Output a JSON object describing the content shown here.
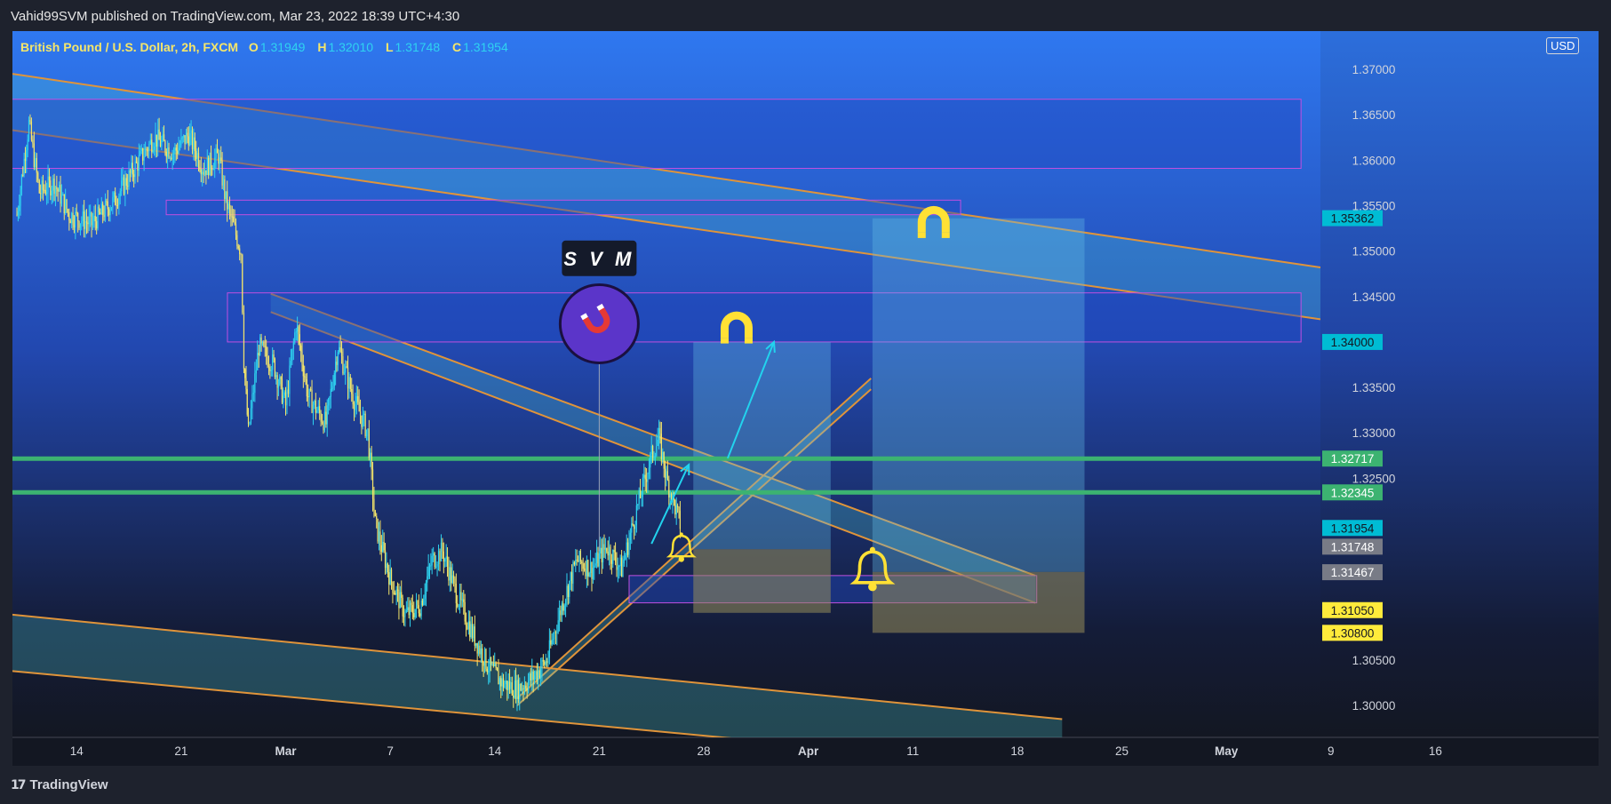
{
  "header": {
    "publisher": "Vahid99SVM published on TradingView.com, Mar 23, 2022 18:39 UTC+4:30"
  },
  "legend": {
    "symbol": "British Pound / U.S. Dollar, 2h, FXCM",
    "o_label": "O",
    "open": "1.31949",
    "h_label": "H",
    "high": "1.32010",
    "l_label": "L",
    "low": "1.31748",
    "c_label": "C",
    "close": "1.31954"
  },
  "currency_button": "USD",
  "watermark": {
    "text": "S V M",
    "icon": "magnet-icon"
  },
  "footer": {
    "brand": "TradingView",
    "icon": "tradingview-logo-icon"
  },
  "colors": {
    "bull": "#2ed3f0",
    "bear": "#f5e66a",
    "support": "#3cb371",
    "channel": "#e0943a",
    "zone_border": "#c14fe0"
  },
  "chart_data": {
    "type": "candlestick",
    "symbol": "GBPUSD",
    "interval": "2h",
    "ylim": [
      1.2965,
      1.3742
    ],
    "x_range_days": [
      -22.3,
      65.3
    ],
    "x_ticks": [
      {
        "day": -18,
        "label": "14"
      },
      {
        "day": -11,
        "label": "21"
      },
      {
        "day": -4,
        "label": "Mar"
      },
      {
        "day": 3,
        "label": "7"
      },
      {
        "day": 10,
        "label": "14"
      },
      {
        "day": 17,
        "label": "21"
      },
      {
        "day": 24,
        "label": "28"
      },
      {
        "day": 31,
        "label": "Apr"
      },
      {
        "day": 38,
        "label": "11"
      },
      {
        "day": 45,
        "label": "18"
      },
      {
        "day": 52,
        "label": "25"
      },
      {
        "day": 59,
        "label": "May"
      },
      {
        "day": 66,
        "label": "9"
      },
      {
        "day": 73,
        "label": "16"
      }
    ],
    "y_ticks": [
      "1.37000",
      "1.36500",
      "1.36000",
      "1.35500",
      "1.35000",
      "1.34500",
      "1.33500",
      "1.33000",
      "1.32500",
      "1.30500",
      "1.30000"
    ],
    "price_labels": [
      {
        "value": 1.35362,
        "text": "1.35362",
        "bg": "#00bcd4",
        "fg": "#131722"
      },
      {
        "value": 1.34,
        "text": "1.34000",
        "bg": "#00bcd4",
        "fg": "#131722"
      },
      {
        "value": 1.32717,
        "text": "1.32717",
        "bg": "#3cb371",
        "fg": "#ffffff"
      },
      {
        "value": 1.32345,
        "text": "1.32345",
        "bg": "#3cb371",
        "fg": "#ffffff"
      },
      {
        "value": 1.31954,
        "text": "1.31954",
        "bg": "#00bcd4",
        "fg": "#131722"
      },
      {
        "value": 1.31748,
        "text": "1.31748",
        "bg": "#787b86",
        "fg": "#ffffff"
      },
      {
        "value": 1.31467,
        "text": "1.31467",
        "bg": "#787b86",
        "fg": "#ffffff"
      },
      {
        "value": 1.3105,
        "text": "1.31050",
        "bg": "#ffeb3b",
        "fg": "#131722"
      },
      {
        "value": 1.308,
        "text": "1.30800",
        "bg": "#ffeb3b",
        "fg": "#131722"
      }
    ],
    "horizontal_lines": [
      {
        "value": 1.32717
      },
      {
        "value": 1.32345
      }
    ],
    "zones": [
      {
        "from_day": -23,
        "to_day": 64,
        "top": 1.3667,
        "bottom": 1.3591
      },
      {
        "from_day": -12,
        "to_day": 41.2,
        "top": 1.3556,
        "bottom": 1.354
      },
      {
        "from_day": -7.9,
        "to_day": 64,
        "top": 1.3454,
        "bottom": 1.34
      },
      {
        "from_day": 19,
        "to_day": 46.3,
        "top": 1.3143,
        "bottom": 1.3113
      }
    ],
    "channels": [
      {
        "x1": -22.3,
        "y1_top": 1.3695,
        "y1_bot": 1.3633,
        "x2": 65.3,
        "y2_top": 1.3482,
        "y2_bot": 1.3425
      },
      {
        "x1": -5,
        "y1_top": 1.3453,
        "y1_bot": 1.3433,
        "x2": 46.2,
        "y2_top": 1.3143,
        "y2_bot": 1.3113
      },
      {
        "x1": 11.5,
        "y1_top": 1.3008,
        "y1_bot": 1.3,
        "x2": 35.2,
        "y2_top": 1.336,
        "y2_bot": 1.3348
      },
      {
        "x1": -22.3,
        "y1_top": 1.31,
        "y1_bot": 1.3038,
        "x2": 48,
        "y2_top": 1.2985,
        "y2_bot": 1.293
      }
    ],
    "positions": [
      {
        "from_day": 23.3,
        "to_day": 32.5,
        "entry": 1.3172,
        "target": 1.34,
        "stop": 1.3102
      },
      {
        "from_day": 35.3,
        "to_day": 49.5,
        "entry": 1.3147,
        "target": 1.3536,
        "stop": 1.308
      }
    ],
    "projection_arrows": [
      {
        "points": [
          [
            20.5,
            1.3178
          ],
          [
            23,
            1.3265
          ]
        ]
      },
      {
        "points": [
          [
            25.6,
            1.3272
          ],
          [
            28.7,
            1.34
          ]
        ]
      }
    ],
    "alerts": [
      {
        "day": 22.5,
        "value": 1.3172,
        "icon": "bell-icon"
      },
      {
        "day": 35.3,
        "value": 1.3147,
        "icon": "bell-icon"
      }
    ],
    "magnets": [
      {
        "day": 26.2,
        "value": 1.3414,
        "icon": "magnet-icon"
      },
      {
        "day": 39.4,
        "value": 1.353,
        "icon": "magnet-icon"
      }
    ],
    "price_path": [
      [
        -22,
        1.354
      ],
      [
        -21.2,
        1.364
      ],
      [
        -20.5,
        1.3565
      ],
      [
        -19.5,
        1.3575
      ],
      [
        -18.5,
        1.354
      ],
      [
        -17,
        1.353
      ],
      [
        -15.5,
        1.3555
      ],
      [
        -14,
        1.3595
      ],
      [
        -12.8,
        1.3625
      ],
      [
        -11.5,
        1.3608
      ],
      [
        -10.5,
        1.3628
      ],
      [
        -9.5,
        1.359
      ],
      [
        -8.5,
        1.3605
      ],
      [
        -8,
        1.3555
      ],
      [
        -7,
        1.35
      ],
      [
        -6.8,
        1.338
      ],
      [
        -6.5,
        1.33
      ],
      [
        -5.8,
        1.3395
      ],
      [
        -4.8,
        1.3375
      ],
      [
        -4,
        1.333
      ],
      [
        -3.3,
        1.342
      ],
      [
        -2.5,
        1.334
      ],
      [
        -1.3,
        1.331
      ],
      [
        -0.5,
        1.3395
      ],
      [
        0.5,
        1.334
      ],
      [
        1.5,
        1.33
      ],
      [
        2,
        1.32
      ],
      [
        3,
        1.314
      ],
      [
        4,
        1.31
      ],
      [
        5,
        1.311
      ],
      [
        5.8,
        1.316
      ],
      [
        6.5,
        1.317
      ],
      [
        7.5,
        1.312
      ],
      [
        8.5,
        1.308
      ],
      [
        9.5,
        1.3045
      ],
      [
        10.5,
        1.3025
      ],
      [
        11.5,
        1.3018
      ],
      [
        12.5,
        1.303
      ],
      [
        13.5,
        1.305
      ],
      [
        14.5,
        1.311
      ],
      [
        15.5,
        1.316
      ],
      [
        16.5,
        1.315
      ],
      [
        17.5,
        1.3175
      ],
      [
        18.5,
        1.315
      ],
      [
        19.5,
        1.3215
      ],
      [
        20.5,
        1.3275
      ],
      [
        21,
        1.3295
      ],
      [
        21.5,
        1.325
      ],
      [
        22.5,
        1.3195
      ]
    ]
  }
}
